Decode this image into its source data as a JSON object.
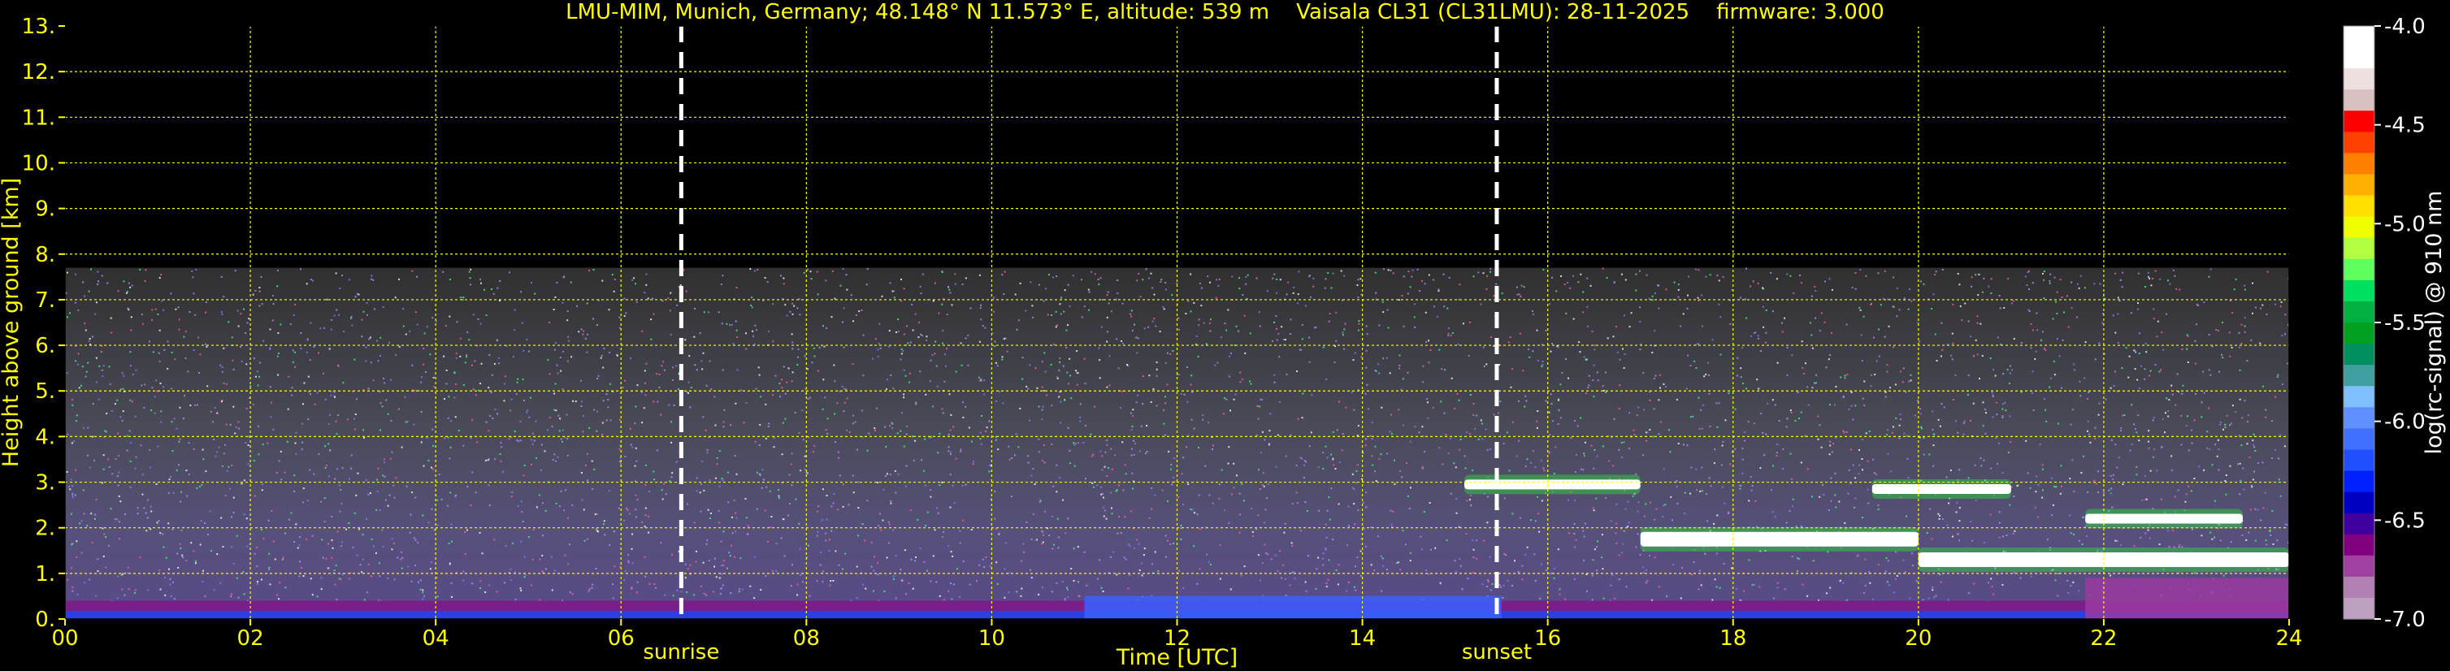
{
  "title": "LMU-MIM, Munich, Germany; 48.148° N 11.573° E, altitude: 539 m    Vaisala CL31 (CL31LMU): 28-11-2025    firmware: 3.000",
  "colors": {
    "text": "#ffff00",
    "background": "#000000",
    "grid": "#ffff00",
    "marker": "#ffffff"
  },
  "chart_data": {
    "type": "heatmap",
    "title": "LMU-MIM, Munich, Germany; 48.148° N 11.573° E, altitude: 539 m    Vaisala CL31 (CL31LMU): 28-11-2025    firmware: 3.000",
    "xlabel": "Time [UTC]",
    "ylabel": "Height above ground [km]",
    "xlim": [
      0,
      24
    ],
    "ylim": [
      0,
      13
    ],
    "x_ticks": [
      "00",
      "02",
      "04",
      "06",
      "08",
      "10",
      "12",
      "14",
      "16",
      "18",
      "20",
      "22",
      "24"
    ],
    "y_ticks": [
      "0.",
      "1.",
      "2.",
      "3.",
      "4.",
      "5.",
      "6.",
      "7.",
      "8.",
      "9.",
      "10.",
      "11.",
      "12.",
      "13."
    ],
    "grid": true,
    "noise_top_km": 7.7,
    "markers": [
      {
        "label": "sunrise",
        "x": 6.65
      },
      {
        "label": "sunset",
        "x": 15.45
      }
    ],
    "cloud_layers": [
      {
        "x": [
          15.1,
          17.0
        ],
        "y": 2.95
      },
      {
        "x": [
          17.0,
          20.0
        ],
        "y": 1.75
      },
      {
        "x": [
          20.0,
          24.0
        ],
        "y": 1.3
      },
      {
        "x": [
          19.5,
          21.0
        ],
        "y": 2.85
      },
      {
        "x": [
          21.8,
          23.5
        ],
        "y": 2.2
      }
    ],
    "boundary_layer": {
      "top_km": 0.4
    },
    "colorbar": {
      "label": "log(rc-signal) @ 910 nm",
      "range": [
        -7.0,
        -4.0
      ],
      "ticks": [
        "-4.0",
        "-4.5",
        "-5.0",
        "-5.5",
        "-6.0",
        "-6.5",
        "-7.0"
      ],
      "colors": [
        "#ffffff",
        "#ffffff",
        "#f0e0e0",
        "#d8c0c0",
        "#ff0000",
        "#ff4000",
        "#ff8000",
        "#ffb000",
        "#ffe000",
        "#f0ff00",
        "#b0ff40",
        "#60ff60",
        "#00e060",
        "#00b040",
        "#00a020",
        "#009060",
        "#40a0a0",
        "#80c0ff",
        "#6090ff",
        "#4070ff",
        "#2050ff",
        "#0020ff",
        "#0000c0",
        "#4000a0",
        "#800080",
        "#a040a0",
        "#b080b0",
        "#c0a0c0"
      ]
    }
  }
}
